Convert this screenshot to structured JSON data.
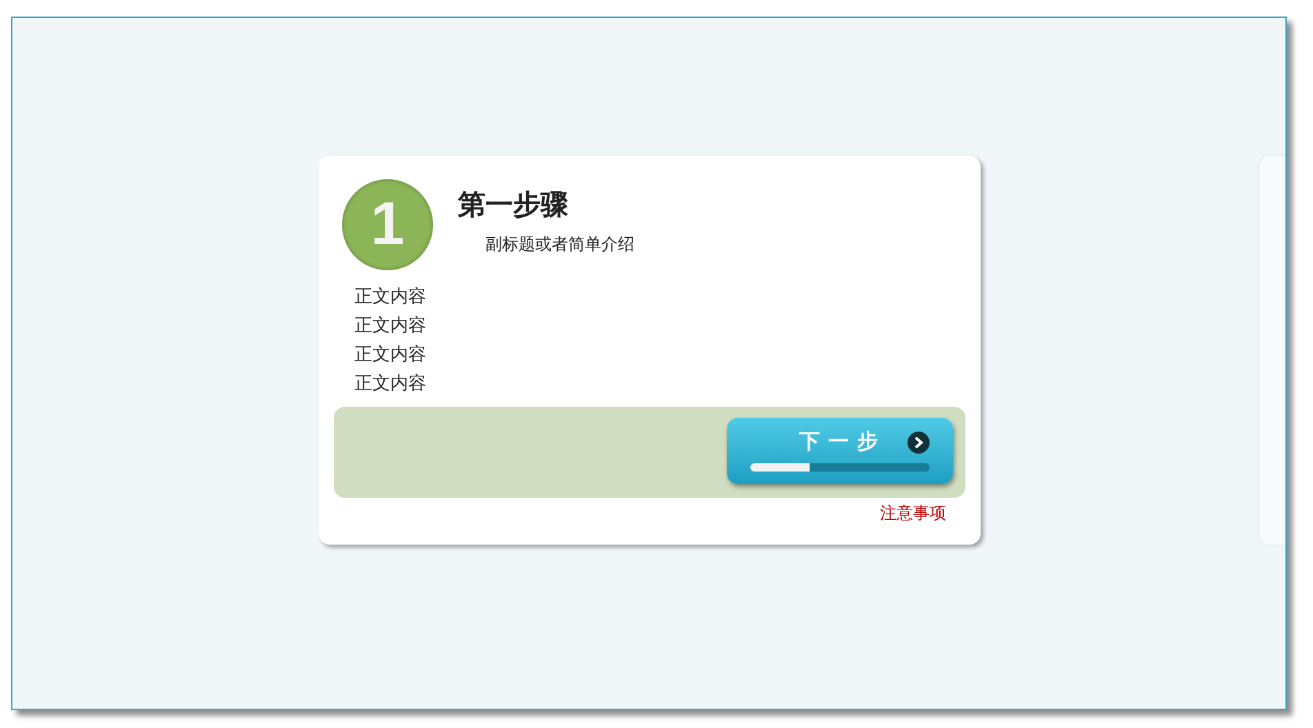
{
  "step": {
    "number": "1",
    "title": "第一步骤",
    "subtitle": "副标题或者简单介绍",
    "body": [
      "正文内容",
      "正文内容",
      "正文内容",
      "正文内容"
    ],
    "next_button": {
      "label": "下一步",
      "level": 0.33
    },
    "note": "注意事项"
  }
}
